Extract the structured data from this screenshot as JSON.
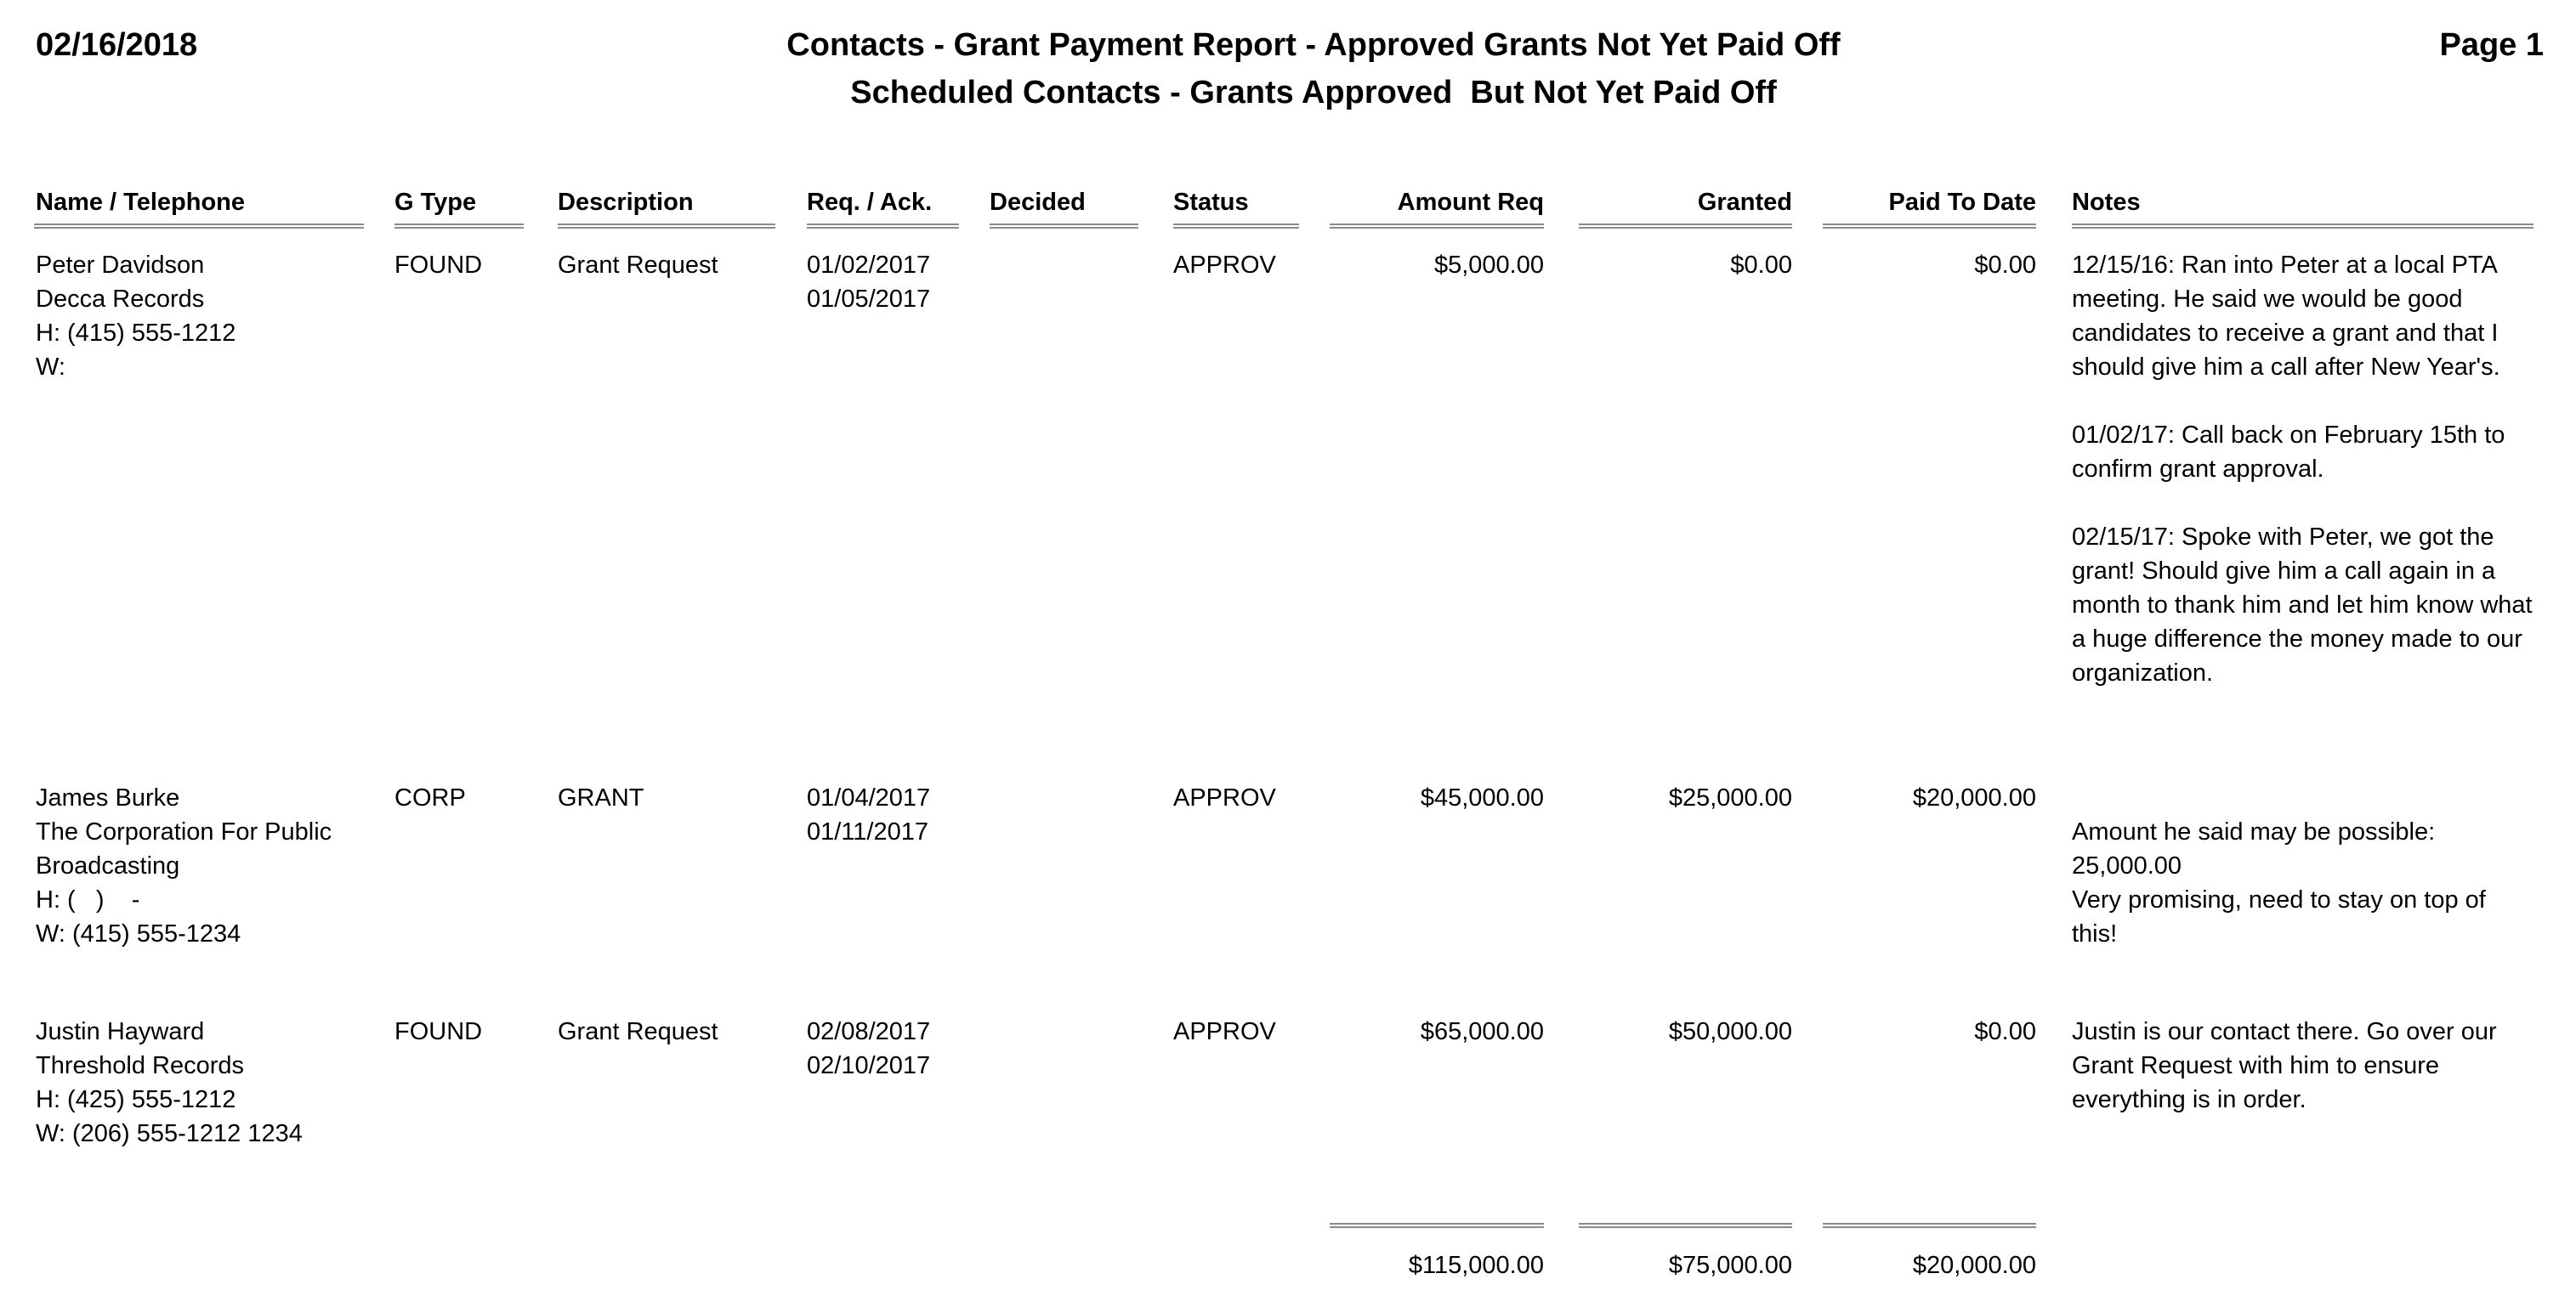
{
  "header": {
    "date": "02/16/2018",
    "title": "Contacts - Grant Payment Report - Approved Grants Not Yet Paid Off",
    "subtitle": "Scheduled Contacts - Grants Approved  But Not Yet Paid Off",
    "page": "Page 1"
  },
  "columns": {
    "name": "Name / Telephone",
    "gtype": "G Type",
    "description": "Description",
    "req_ack": "Req. / Ack.",
    "decided": "Decided",
    "status": "Status",
    "amount_req": "Amount Req",
    "granted": "Granted",
    "paid": "Paid To Date",
    "notes": "Notes"
  },
  "rows": [
    {
      "name": "Peter Davidson\nDecca Records\nH: (415) 555-1212\nW:",
      "gtype": "FOUND",
      "description": "Grant Request",
      "req_ack": "01/02/2017\n01/05/2017",
      "decided": "",
      "status": "APPROV",
      "amount_req": "$5,000.00",
      "granted": "$0.00",
      "paid": "$0.00",
      "notes": [
        "12/15/16: Ran into Peter at a local PTA meeting. He said we would be good candidates to receive a grant and that I should give him a call after New Year's.",
        "01/02/17: Call back on February 15th to confirm grant approval.",
        "02/15/17: Spoke with Peter, we got the grant! Should give him a call again in a month to thank him and let him know what a huge difference the money made to our organization."
      ]
    },
    {
      "name": "James Burke\nThe Corporation For Public\nBroadcasting\nH: (   )    -\nW: (415) 555-1234",
      "gtype": "CORP",
      "description": "GRANT",
      "req_ack": "01/04/2017\n01/11/2017",
      "decided": "",
      "status": "APPROV",
      "amount_req": "$45,000.00",
      "granted": "$25,000.00",
      "paid": "$20,000.00",
      "notes": [
        "Amount he said may be possible: 25,000.00\nVery promising, need to stay on top of this!"
      ]
    },
    {
      "name": "Justin Hayward\nThreshold Records\nH: (425) 555-1212\nW: (206) 555-1212 1234",
      "gtype": "FOUND",
      "description": "Grant Request",
      "req_ack": "02/08/2017\n02/10/2017",
      "decided": "",
      "status": "APPROV",
      "amount_req": "$65,000.00",
      "granted": "$50,000.00",
      "paid": "$0.00",
      "notes": [
        "Justin is our contact there. Go over our Grant Request with him to ensure everything is in order."
      ]
    }
  ],
  "totals": {
    "amount_req": "$115,000.00",
    "granted": "$75,000.00",
    "paid": "$20,000.00"
  }
}
